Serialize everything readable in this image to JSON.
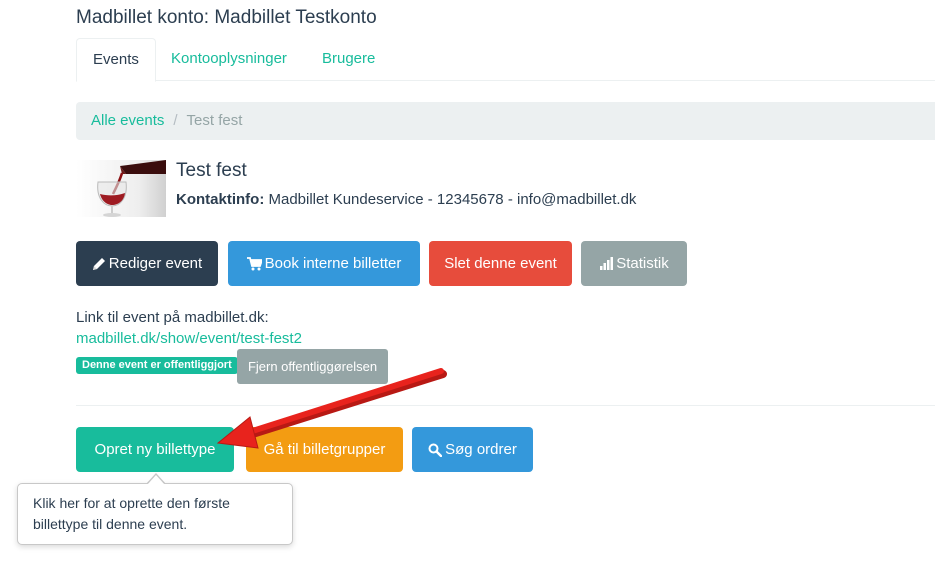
{
  "page": {
    "title": "Madbillet konto: Madbillet Testkonto"
  },
  "tabs": [
    {
      "label": "Events",
      "active": true
    },
    {
      "label": "Kontooplysninger",
      "active": false
    },
    {
      "label": "Brugere",
      "active": false
    }
  ],
  "breadcrumb": {
    "link": "Alle events",
    "separator": "/",
    "current": "Test fest"
  },
  "event": {
    "title": "Test fest",
    "contact_label": "Kontaktinfo:",
    "contact_value": "Madbillet Kundeservice - 12345678 - info@madbillet.dk",
    "image_icon": "wine-glass-image"
  },
  "actions": {
    "edit": {
      "label": "Rediger event",
      "icon": "pencil-icon"
    },
    "book": {
      "label": "Book interne billetter",
      "icon": "cart-icon"
    },
    "delete": {
      "label": "Slet denne event"
    },
    "stats": {
      "label": "Statistik",
      "icon": "bar-chart-icon"
    }
  },
  "link_section": {
    "label": "Link til event på madbillet.dk:",
    "url": "madbillet.dk/show/event/test-fest2",
    "published_badge": "Denne event er offentliggjort",
    "unpublish_button": "Fjern offentliggørelsen"
  },
  "ticket_actions": {
    "create": {
      "label": "Opret ny billettype"
    },
    "groups": {
      "label": "Gå til billetgrupper"
    },
    "search": {
      "label": "Søg ordrer",
      "icon": "search-icon"
    }
  },
  "tooltip": {
    "text": "Klik her for at oprette den første billettype til denne event."
  },
  "colors": {
    "primary_dark": "#2c3e50",
    "success": "#18bc9c",
    "info": "#3498db",
    "danger": "#e74c3c",
    "default": "#95a5a6",
    "warning": "#f39c12",
    "annotation_arrow": "#e8231d"
  }
}
